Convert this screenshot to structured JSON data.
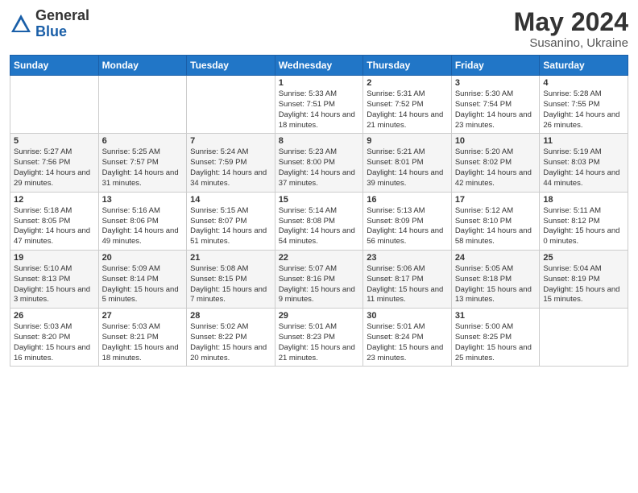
{
  "header": {
    "logo_general": "General",
    "logo_blue": "Blue",
    "title": "May 2024",
    "location": "Susanino, Ukraine"
  },
  "weekdays": [
    "Sunday",
    "Monday",
    "Tuesday",
    "Wednesday",
    "Thursday",
    "Friday",
    "Saturday"
  ],
  "weeks": [
    [
      {
        "day": "",
        "detail": ""
      },
      {
        "day": "",
        "detail": ""
      },
      {
        "day": "",
        "detail": ""
      },
      {
        "day": "1",
        "detail": "Sunrise: 5:33 AM\nSunset: 7:51 PM\nDaylight: 14 hours\nand 18 minutes."
      },
      {
        "day": "2",
        "detail": "Sunrise: 5:31 AM\nSunset: 7:52 PM\nDaylight: 14 hours\nand 21 minutes."
      },
      {
        "day": "3",
        "detail": "Sunrise: 5:30 AM\nSunset: 7:54 PM\nDaylight: 14 hours\nand 23 minutes."
      },
      {
        "day": "4",
        "detail": "Sunrise: 5:28 AM\nSunset: 7:55 PM\nDaylight: 14 hours\nand 26 minutes."
      }
    ],
    [
      {
        "day": "5",
        "detail": "Sunrise: 5:27 AM\nSunset: 7:56 PM\nDaylight: 14 hours\nand 29 minutes."
      },
      {
        "day": "6",
        "detail": "Sunrise: 5:25 AM\nSunset: 7:57 PM\nDaylight: 14 hours\nand 31 minutes."
      },
      {
        "day": "7",
        "detail": "Sunrise: 5:24 AM\nSunset: 7:59 PM\nDaylight: 14 hours\nand 34 minutes."
      },
      {
        "day": "8",
        "detail": "Sunrise: 5:23 AM\nSunset: 8:00 PM\nDaylight: 14 hours\nand 37 minutes."
      },
      {
        "day": "9",
        "detail": "Sunrise: 5:21 AM\nSunset: 8:01 PM\nDaylight: 14 hours\nand 39 minutes."
      },
      {
        "day": "10",
        "detail": "Sunrise: 5:20 AM\nSunset: 8:02 PM\nDaylight: 14 hours\nand 42 minutes."
      },
      {
        "day": "11",
        "detail": "Sunrise: 5:19 AM\nSunset: 8:03 PM\nDaylight: 14 hours\nand 44 minutes."
      }
    ],
    [
      {
        "day": "12",
        "detail": "Sunrise: 5:18 AM\nSunset: 8:05 PM\nDaylight: 14 hours\nand 47 minutes."
      },
      {
        "day": "13",
        "detail": "Sunrise: 5:16 AM\nSunset: 8:06 PM\nDaylight: 14 hours\nand 49 minutes."
      },
      {
        "day": "14",
        "detail": "Sunrise: 5:15 AM\nSunset: 8:07 PM\nDaylight: 14 hours\nand 51 minutes."
      },
      {
        "day": "15",
        "detail": "Sunrise: 5:14 AM\nSunset: 8:08 PM\nDaylight: 14 hours\nand 54 minutes."
      },
      {
        "day": "16",
        "detail": "Sunrise: 5:13 AM\nSunset: 8:09 PM\nDaylight: 14 hours\nand 56 minutes."
      },
      {
        "day": "17",
        "detail": "Sunrise: 5:12 AM\nSunset: 8:10 PM\nDaylight: 14 hours\nand 58 minutes."
      },
      {
        "day": "18",
        "detail": "Sunrise: 5:11 AM\nSunset: 8:12 PM\nDaylight: 15 hours\nand 0 minutes."
      }
    ],
    [
      {
        "day": "19",
        "detail": "Sunrise: 5:10 AM\nSunset: 8:13 PM\nDaylight: 15 hours\nand 3 minutes."
      },
      {
        "day": "20",
        "detail": "Sunrise: 5:09 AM\nSunset: 8:14 PM\nDaylight: 15 hours\nand 5 minutes."
      },
      {
        "day": "21",
        "detail": "Sunrise: 5:08 AM\nSunset: 8:15 PM\nDaylight: 15 hours\nand 7 minutes."
      },
      {
        "day": "22",
        "detail": "Sunrise: 5:07 AM\nSunset: 8:16 PM\nDaylight: 15 hours\nand 9 minutes."
      },
      {
        "day": "23",
        "detail": "Sunrise: 5:06 AM\nSunset: 8:17 PM\nDaylight: 15 hours\nand 11 minutes."
      },
      {
        "day": "24",
        "detail": "Sunrise: 5:05 AM\nSunset: 8:18 PM\nDaylight: 15 hours\nand 13 minutes."
      },
      {
        "day": "25",
        "detail": "Sunrise: 5:04 AM\nSunset: 8:19 PM\nDaylight: 15 hours\nand 15 minutes."
      }
    ],
    [
      {
        "day": "26",
        "detail": "Sunrise: 5:03 AM\nSunset: 8:20 PM\nDaylight: 15 hours\nand 16 minutes."
      },
      {
        "day": "27",
        "detail": "Sunrise: 5:03 AM\nSunset: 8:21 PM\nDaylight: 15 hours\nand 18 minutes."
      },
      {
        "day": "28",
        "detail": "Sunrise: 5:02 AM\nSunset: 8:22 PM\nDaylight: 15 hours\nand 20 minutes."
      },
      {
        "day": "29",
        "detail": "Sunrise: 5:01 AM\nSunset: 8:23 PM\nDaylight: 15 hours\nand 21 minutes."
      },
      {
        "day": "30",
        "detail": "Sunrise: 5:01 AM\nSunset: 8:24 PM\nDaylight: 15 hours\nand 23 minutes."
      },
      {
        "day": "31",
        "detail": "Sunrise: 5:00 AM\nSunset: 8:25 PM\nDaylight: 15 hours\nand 25 minutes."
      },
      {
        "day": "",
        "detail": ""
      }
    ]
  ]
}
